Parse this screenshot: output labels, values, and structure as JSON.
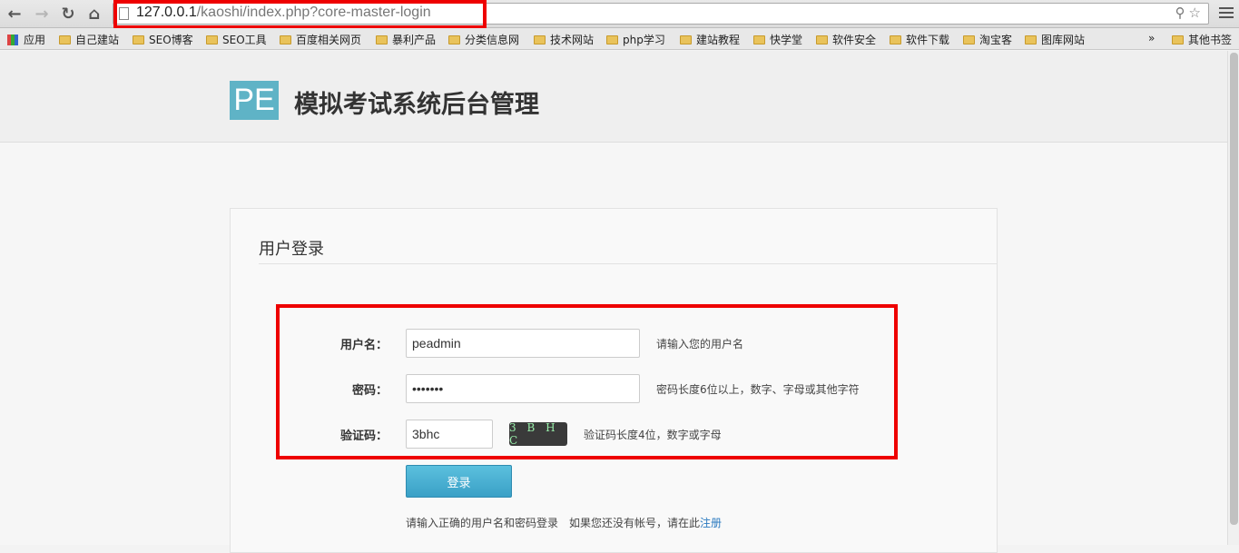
{
  "browser": {
    "url_host": "127.0.0.1",
    "url_path": "/kaoshi/index.php?core-master-login",
    "bookmarks": [
      {
        "label": "应用",
        "icon": "apps-grid-icon"
      },
      {
        "label": "自己建站",
        "icon": "folder-icon"
      },
      {
        "label": "SEO博客",
        "icon": "folder-icon"
      },
      {
        "label": "SEO工具",
        "icon": "folder-icon"
      },
      {
        "label": "百度相关网页",
        "icon": "folder-icon"
      },
      {
        "label": "暴利产品",
        "icon": "folder-icon"
      },
      {
        "label": "分类信息网",
        "icon": "folder-icon"
      },
      {
        "label": "技术网站",
        "icon": "folder-icon"
      },
      {
        "label": "php学习",
        "icon": "folder-icon"
      },
      {
        "label": "建站教程",
        "icon": "folder-icon"
      },
      {
        "label": "快学堂",
        "icon": "folder-icon"
      },
      {
        "label": "软件安全",
        "icon": "folder-icon"
      },
      {
        "label": "软件下载",
        "icon": "folder-icon"
      },
      {
        "label": "淘宝客",
        "icon": "folder-icon"
      },
      {
        "label": "图库网站",
        "icon": "folder-icon"
      }
    ],
    "overflow": "»",
    "other_bookmarks": "其他书签"
  },
  "header": {
    "logo_text": "PE",
    "title": "模拟考试系统后台管理"
  },
  "login": {
    "panel_title": "用户登录",
    "username_label": "用户名：",
    "username_value": "peadmin",
    "username_hint": "请输入您的用户名",
    "password_label": "密码：",
    "password_value": "•••••••",
    "password_hint": "密码长度6位以上，数字、字母或其他字符",
    "captcha_label": "验证码：",
    "captcha_value": "3bhc",
    "captcha_image_text": "3 B H C",
    "captcha_hint": "验证码长度4位，数字或字母",
    "submit_label": "登录",
    "note_text": "请输入正确的用户名和密码登录　如果您还没有帐号，请在此",
    "register_link": "注册"
  },
  "colors": {
    "accent": "#5fb3c6",
    "button": "#46b1d6",
    "highlight_box": "#ee0000",
    "link": "#2a7ac0"
  }
}
